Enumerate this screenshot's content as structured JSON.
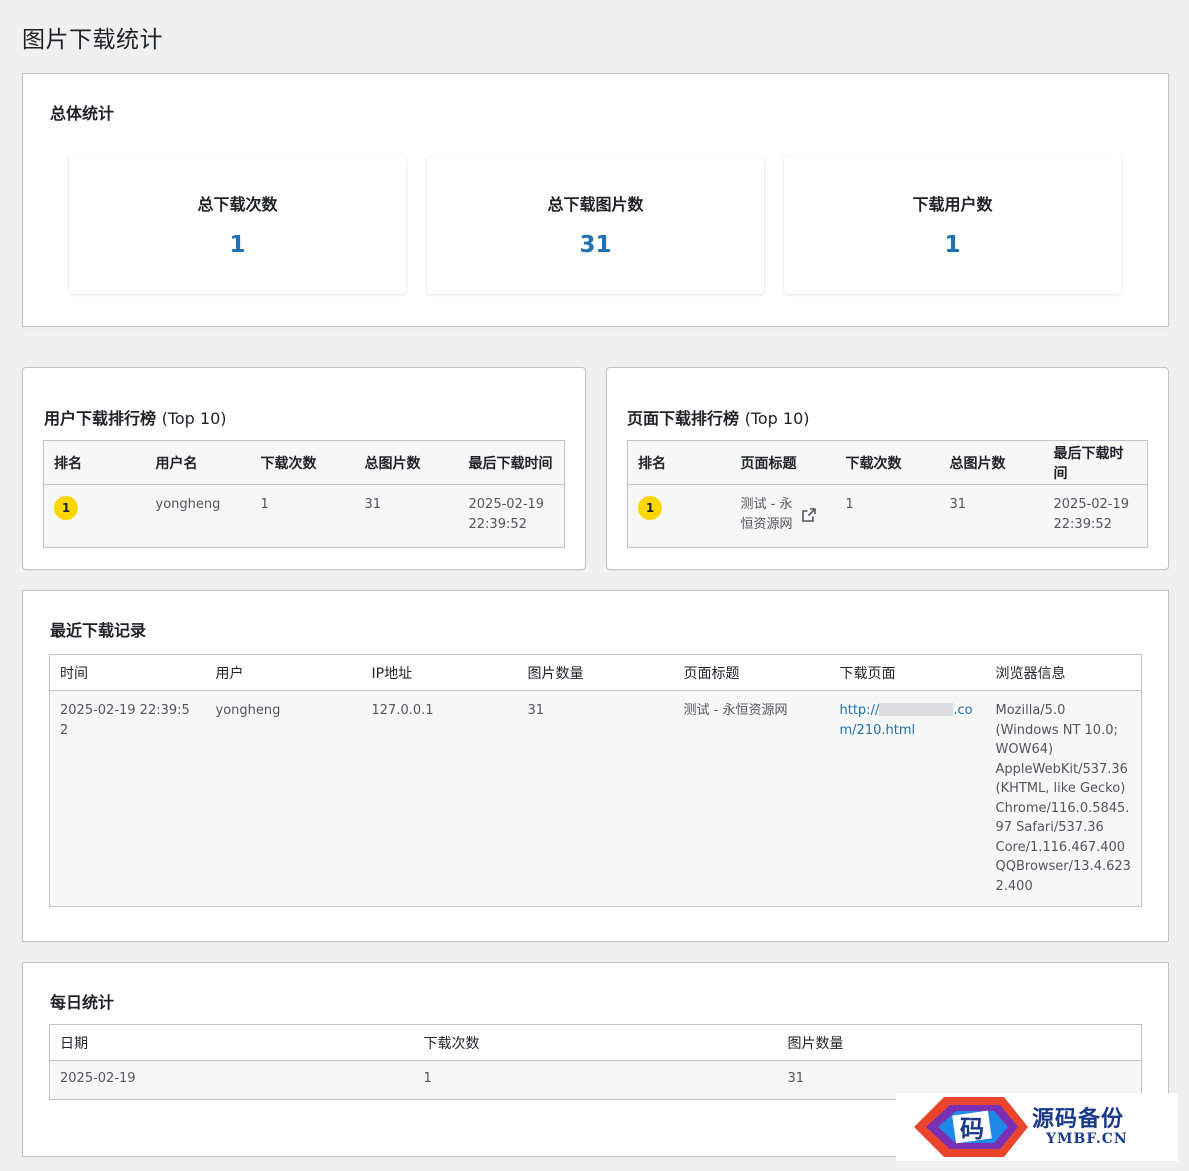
{
  "page": {
    "title": "图片下载统计"
  },
  "overall": {
    "heading": "总体统计",
    "stats": [
      {
        "label": "总下载次数",
        "value": "1"
      },
      {
        "label": "总下载图片数",
        "value": "31"
      },
      {
        "label": "下载用户数",
        "value": "1"
      }
    ]
  },
  "user_rank": {
    "heading": "用户下载排行榜",
    "heading_suffix": "(Top 10)",
    "columns": [
      "排名",
      "用户名",
      "下载次数",
      "总图片数",
      "最后下载时间"
    ],
    "rows": [
      {
        "rank": "1",
        "user": "yongheng",
        "downloads": "1",
        "images": "31",
        "last_time": "2025-02-19 22:39:52"
      }
    ]
  },
  "page_rank": {
    "heading": "页面下载排行榜",
    "heading_suffix": "(Top 10)",
    "columns": [
      "排名",
      "页面标题",
      "下载次数",
      "总图片数",
      "最后下载时间"
    ],
    "rows": [
      {
        "rank": "1",
        "title": "测试 - 永恒资源网",
        "icon": "external-link-icon",
        "downloads": "1",
        "images": "31",
        "last_time": "2025-02-19 22:39:52"
      }
    ]
  },
  "recent": {
    "heading": "最近下载记录",
    "columns": [
      "时间",
      "用户",
      "IP地址",
      "图片数量",
      "页面标题",
      "下载页面",
      "浏览器信息"
    ],
    "rows": [
      {
        "time": "2025-02-19 22:39:52",
        "user": "yongheng",
        "ip": "127.0.0.1",
        "count": "31",
        "title": "测试 - 永恒资源网",
        "url_prefix": "http://",
        "url_suffix": ".com/210.html",
        "browser": "Mozilla/5.0 (Windows NT 10.0; WOW64) AppleWebKit/537.36 (KHTML, like Gecko) Chrome/116.0.5845.97 Safari/537.36 Core/1.116.467.400 QQBrowser/13.4.6232.400"
      }
    ]
  },
  "daily": {
    "heading": "每日统计",
    "columns": [
      "日期",
      "下载次数",
      "图片数量"
    ],
    "rows": [
      {
        "date": "2025-02-19",
        "downloads": "1",
        "images": "31"
      }
    ]
  },
  "watermark": {
    "cn": "源码备份",
    "en": "YMBF.CN",
    "glyph": "码"
  },
  "colors": {
    "accent": "#2271b1",
    "badge": "#ffd700",
    "background": "#f0f0f1"
  }
}
